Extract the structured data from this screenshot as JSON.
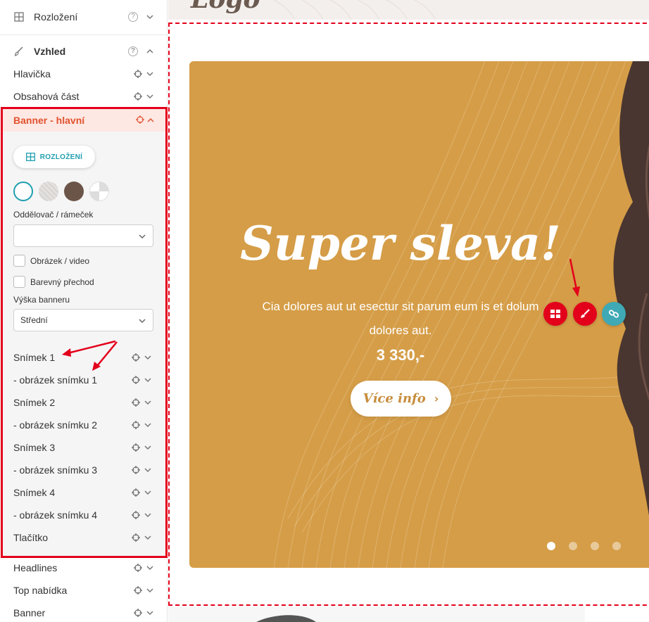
{
  "sidebar": {
    "layout_section": {
      "label": "Rozložení",
      "help": "?"
    },
    "appearance_section": {
      "label": "Vzhled",
      "help": "?"
    },
    "items_top": [
      {
        "label": "Hlavička"
      },
      {
        "label": "Obsahová část"
      }
    ],
    "banner_panel": {
      "title": "Banner - hlavní",
      "layout_button": "ROZLOŽENÍ",
      "swatches": [
        "#ffffff",
        "#d9d5d3",
        "#6b5548",
        "#e8e8e8"
      ],
      "divider_label": "Oddělovač / rámeček",
      "divider_value": "",
      "image_video_label": "Obrázek / video",
      "color_transition_label": "Barevný přechod",
      "height_label": "Výška banneru",
      "height_value": "Střední",
      "items": [
        {
          "label": "Snímek 1"
        },
        {
          "label": "- obrázek snímku 1"
        },
        {
          "label": "Snímek 2"
        },
        {
          "label": "- obrázek snímku 2"
        },
        {
          "label": "Snímek 3"
        },
        {
          "label": "- obrázek snímku 3"
        },
        {
          "label": "Snímek 4"
        },
        {
          "label": "- obrázek snímku 4"
        },
        {
          "label": "Tlačítko"
        }
      ]
    },
    "items_bottom": [
      {
        "label": "Headlines"
      },
      {
        "label": "Top nabídka"
      },
      {
        "label": "Banner"
      }
    ]
  },
  "banner": {
    "title": "Super sleva!",
    "text": "Cia dolores aut ut esectur sit parum eum is et dolum dolores aut.",
    "price": "3 330,-",
    "button": "Více info",
    "slides_total": 4,
    "active_slide": 1,
    "background": "#d59d47"
  },
  "colors": {
    "accent_red": "#e3001b",
    "teal": "#3fa9b5",
    "orange_text": "#e2522e"
  }
}
